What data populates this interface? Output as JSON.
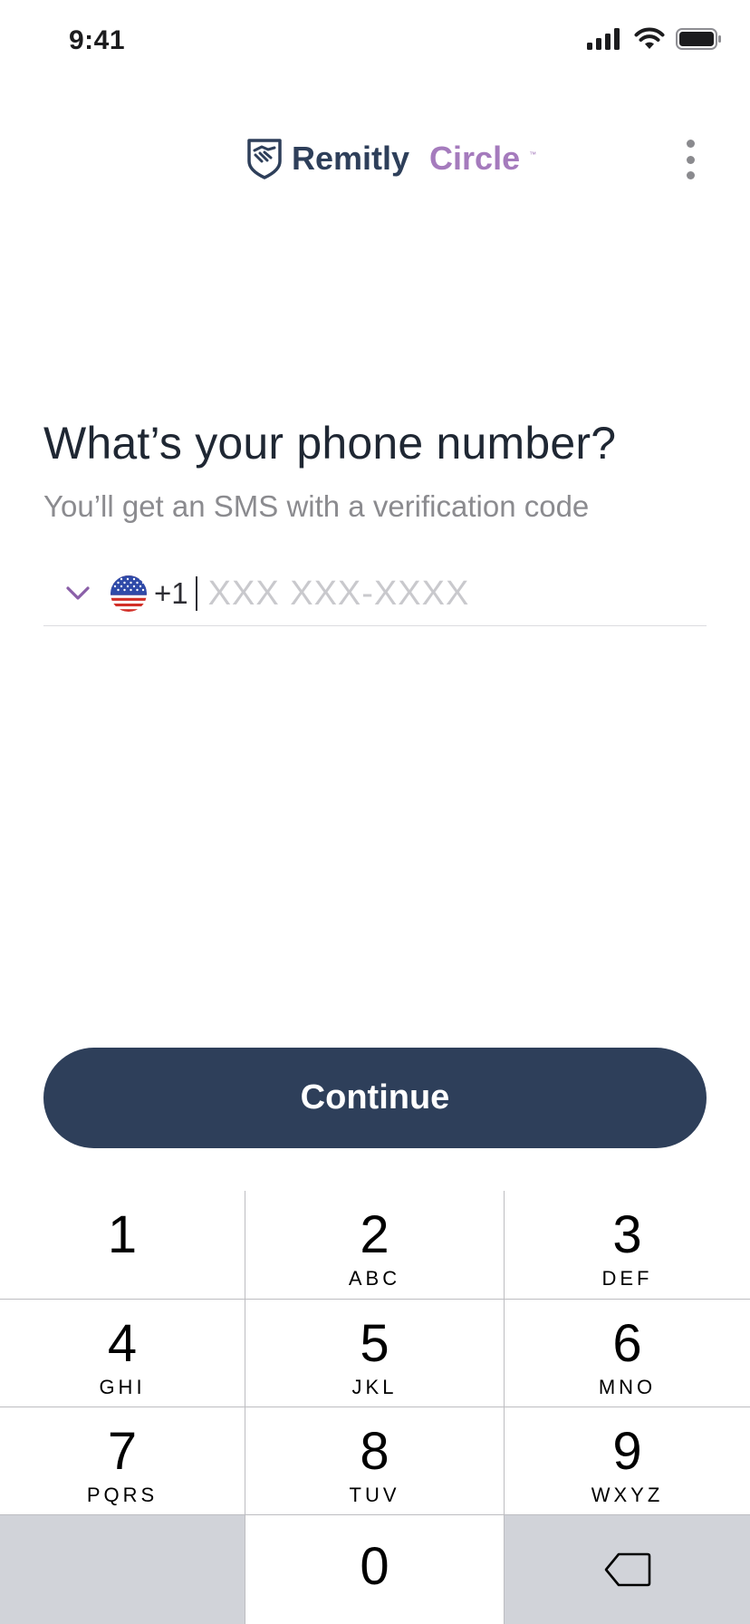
{
  "status_bar": {
    "time": "9:41"
  },
  "header": {
    "logo_brand": "Remitly",
    "logo_product": "Circle",
    "logo_tm": "™"
  },
  "main": {
    "title": "What’s your phone number?",
    "subtitle": "You’ll get an SMS with a verification code",
    "phone": {
      "country_flag": "us-flag-icon",
      "dial_code": "+1",
      "value": "",
      "placeholder": "XXX XXX-XXXX"
    }
  },
  "actions": {
    "continue_label": "Continue"
  },
  "keypad": {
    "keys": [
      {
        "digit": "1",
        "letters": ""
      },
      {
        "digit": "2",
        "letters": "ABC"
      },
      {
        "digit": "3",
        "letters": "DEF"
      },
      {
        "digit": "4",
        "letters": "GHI"
      },
      {
        "digit": "5",
        "letters": "JKL"
      },
      {
        "digit": "6",
        "letters": "MNO"
      },
      {
        "digit": "7",
        "letters": "PQRS"
      },
      {
        "digit": "8",
        "letters": "TUV"
      },
      {
        "digit": "9",
        "letters": "WXYZ"
      },
      {
        "digit": "0",
        "letters": ""
      }
    ],
    "delete_icon": "backspace-icon"
  },
  "colors": {
    "brand_navy": "#2e3f5a",
    "brand_purple": "#a57bbd",
    "keypad_gray": "#d1d3d9"
  }
}
